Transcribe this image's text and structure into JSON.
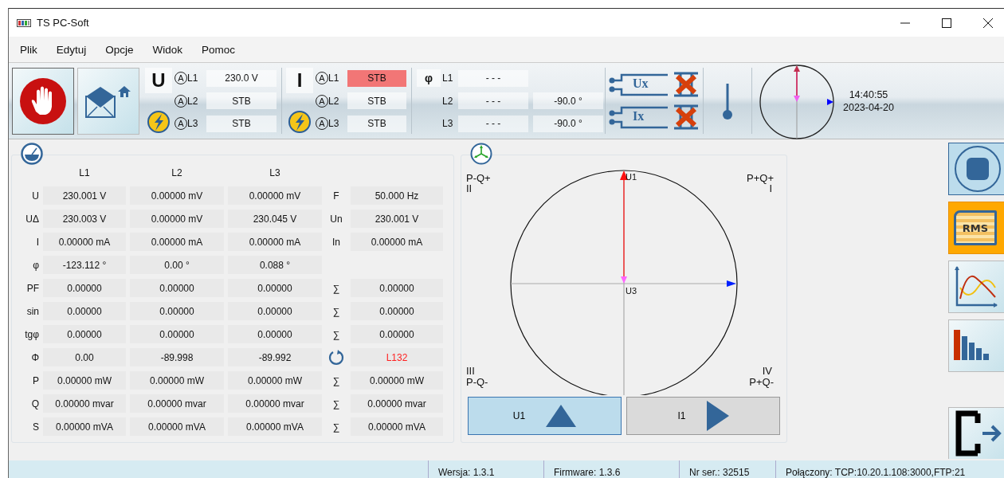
{
  "window": {
    "title": "TS PC-Soft"
  },
  "menu": [
    "Plik",
    "Edytuj",
    "Opcje",
    "Widok",
    "Pomoc"
  ],
  "toolbar": {
    "voltage": {
      "symbol": "U",
      "rows": [
        {
          "unit": "A",
          "phase": "L1",
          "value": "230.0 V",
          "alarm": false
        },
        {
          "unit": "A",
          "phase": "L2",
          "value": "STB",
          "alarm": false
        },
        {
          "unit": "A",
          "phase": "L3",
          "value": "STB",
          "alarm": false
        }
      ]
    },
    "current": {
      "symbol": "I",
      "rows": [
        {
          "unit": "A",
          "phase": "L1",
          "value": "STB",
          "alarm": true
        },
        {
          "unit": "A",
          "phase": "L2",
          "value": "STB",
          "alarm": false
        },
        {
          "unit": "A",
          "phase": "L3",
          "value": "STB",
          "alarm": false
        }
      ]
    },
    "phase": {
      "symbol": "φ",
      "rows": [
        {
          "phase": "L1",
          "value": "- - -"
        },
        {
          "phase": "L2",
          "value": "- - -",
          "angle": "-90.0 °"
        },
        {
          "phase": "L3",
          "value": "- - -",
          "angle": "-90.0 °"
        }
      ]
    },
    "inputs": [
      {
        "label": "Ux",
        "fault": true
      },
      {
        "label": "Ix",
        "fault": true
      }
    ],
    "clock": {
      "time": "14:40:55",
      "date": "2023-04-20"
    }
  },
  "measurements": {
    "columns": [
      "L1",
      "L2",
      "L3"
    ],
    "rows": [
      {
        "label": "U",
        "values": [
          "230.001 V",
          "0.00000 mV",
          "0.00000 mV"
        ],
        "extra": {
          "kind": "label",
          "label": "F",
          "value": "50.000 Hz",
          "alert": false
        }
      },
      {
        "label": "UΔ",
        "values": [
          "230.003 V",
          "0.00000 mV",
          "230.045 V"
        ],
        "extra": {
          "kind": "label",
          "label": "Un",
          "value": "230.001 V",
          "alert": false
        }
      },
      {
        "label": "I",
        "values": [
          "0.00000 mA",
          "0.00000 mA",
          "0.00000 mA"
        ],
        "extra": {
          "kind": "label",
          "label": "In",
          "value": "0.00000 mA",
          "alert": false
        }
      },
      {
        "label": "φ",
        "values": [
          "-123.112 °",
          "0.00 °",
          "0.088 °"
        ]
      },
      {
        "label": "PF",
        "values": [
          "0.00000",
          "0.00000",
          "0.00000"
        ],
        "extra": {
          "kind": "label",
          "label": "∑",
          "value": "0.00000",
          "alert": false
        }
      },
      {
        "label": "sin",
        "values": [
          "0.00000",
          "0.00000",
          "0.00000"
        ],
        "extra": {
          "kind": "label",
          "label": "∑",
          "value": "0.00000",
          "alert": false
        }
      },
      {
        "label": "tgφ",
        "values": [
          "0.00000",
          "0.00000",
          "0.00000"
        ],
        "extra": {
          "kind": "label",
          "label": "∑",
          "value": "0.00000",
          "alert": false
        }
      },
      {
        "label": "Φ",
        "values": [
          "0.00",
          "-89.998",
          "-89.992"
        ],
        "extra": {
          "kind": "rotation",
          "value": "L132",
          "alert": true
        }
      },
      {
        "label": "P",
        "values": [
          "0.00000 mW",
          "0.00000 mW",
          "0.00000 mW"
        ],
        "extra": {
          "kind": "label",
          "label": "∑",
          "value": "0.00000 mW",
          "alert": false
        }
      },
      {
        "label": "Q",
        "values": [
          "0.00000 mvar",
          "0.00000 mvar",
          "0.00000 mvar"
        ],
        "extra": {
          "kind": "label",
          "label": "∑",
          "value": "0.00000 mvar",
          "alert": false
        }
      },
      {
        "label": "S",
        "values": [
          "0.00000 mVA",
          "0.00000 mVA",
          "0.00000 mVA"
        ],
        "extra": {
          "kind": "label",
          "label": "∑",
          "value": "0.00000 mVA",
          "alert": false
        }
      }
    ]
  },
  "vector_diagram": {
    "quadrants": [
      {
        "power": "P-Q+",
        "number": "II"
      },
      {
        "power": "P+Q+",
        "number": "I"
      },
      {
        "power": "P-Q-",
        "number": "III"
      },
      {
        "power": "P+Q-",
        "number": "IV"
      }
    ],
    "vector_labels": [
      "U1",
      "U3"
    ],
    "buttons": [
      {
        "label": "U1",
        "selected": true
      },
      {
        "label": "I1",
        "selected": false
      }
    ]
  },
  "side_buttons": [
    {
      "kind": "record",
      "selected": false
    },
    {
      "kind": "rms",
      "label": "RMS",
      "selected": true
    },
    {
      "kind": "waveform",
      "selected": false
    },
    {
      "kind": "harmonics",
      "selected": false
    },
    {
      "kind": "exit",
      "selected": false
    }
  ],
  "status_bar": [
    "Wersja: 1.3.1",
    "Firmware: 1.3.6",
    "Nr ser.: 32515",
    "Połączony: TCP:10.20.1.108:3000,FTP:21"
  ]
}
